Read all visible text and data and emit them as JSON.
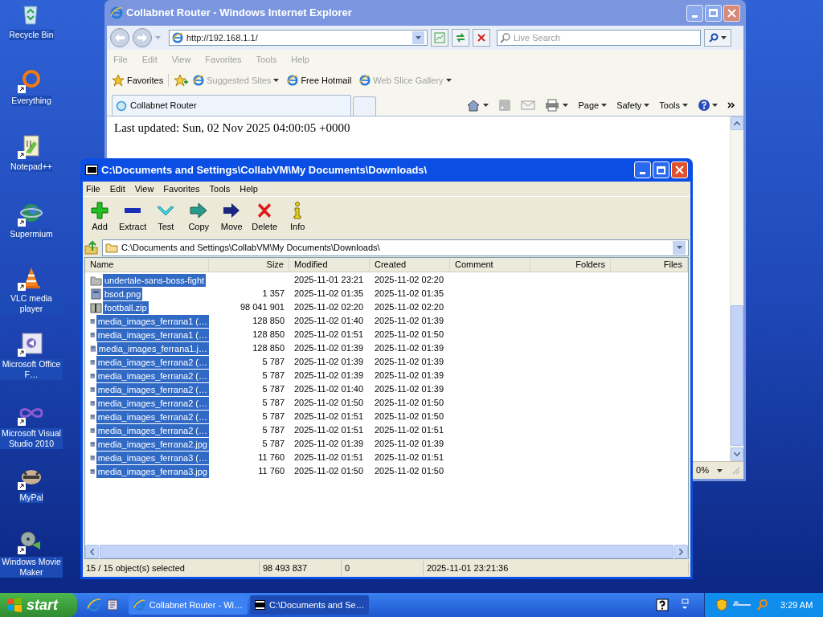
{
  "desktop_icons": [
    {
      "label": "Recycle Bin",
      "kind": "bin",
      "shortcut": false
    },
    {
      "label": "Everything",
      "kind": "ring",
      "shortcut": true
    },
    {
      "label": "Notepad++",
      "kind": "notepad",
      "shortcut": true
    },
    {
      "label": "Supermium",
      "kind": "globe",
      "shortcut": true
    },
    {
      "label": "VLC media player",
      "kind": "cone",
      "shortcut": true
    },
    {
      "label": "Microsoft Office F…",
      "kind": "office",
      "shortcut": true
    },
    {
      "label": "Microsoft Visual Studio 2010",
      "kind": "infinity",
      "shortcut": true
    },
    {
      "label": "MyPal",
      "kind": "raccoon",
      "shortcut": true
    },
    {
      "label": "Windows Movie Maker",
      "kind": "film",
      "shortcut": true
    }
  ],
  "browser": {
    "title": "Collabnet Router - Windows Internet Explorer",
    "address": "http://192.168.1.1/",
    "search_placeholder": "Live Search",
    "menu": [
      "File",
      "Edit",
      "View",
      "Favorites",
      "Tools",
      "Help"
    ],
    "favorites_label": "Favorites",
    "favorites_items": [
      {
        "label": "Suggested Sites",
        "disabled": true,
        "dropdown": true
      },
      {
        "label": "Free Hotmail",
        "disabled": false,
        "dropdown": false
      },
      {
        "label": "Web Slice Gallery",
        "disabled": true,
        "dropdown": true
      }
    ],
    "tab": "Collabnet Router",
    "commands": [
      "Page",
      "Safety",
      "Tools"
    ],
    "content": "Last updated: Sun, 02 Nov 2025 04:00:05 +0000",
    "zoom": "0%"
  },
  "archiver": {
    "title": "C:\\Documents and Settings\\CollabVM\\My Documents\\Downloads\\",
    "menu": [
      "File",
      "Edit",
      "View",
      "Favorites",
      "Tools",
      "Help"
    ],
    "toolbar": [
      {
        "label": "Add",
        "kind": "add"
      },
      {
        "label": "Extract",
        "kind": "extract"
      },
      {
        "label": "Test",
        "kind": "test"
      },
      {
        "label": "Copy",
        "kind": "copy"
      },
      {
        "label": "Move",
        "kind": "move"
      },
      {
        "label": "Delete",
        "kind": "delete"
      },
      {
        "label": "Info",
        "kind": "info"
      }
    ],
    "path": "C:\\Documents and Settings\\CollabVM\\My Documents\\Downloads\\",
    "columns": [
      "Name",
      "Size",
      "Modified",
      "Created",
      "Comment",
      "Folders",
      "Files"
    ],
    "rows": [
      {
        "name": "undertale-sans-boss-fight",
        "size": "",
        "modified": "2025-11-01 23:21",
        "created": "2025-11-02 02:20",
        "kind": "folder",
        "selected": true
      },
      {
        "name": "bsod.png",
        "size": "1 357",
        "modified": "2025-11-02 01:35",
        "created": "2025-11-02 01:35",
        "kind": "image",
        "selected": true
      },
      {
        "name": "football.zip",
        "size": "98 041 901",
        "modified": "2025-11-02 02:20",
        "created": "2025-11-02 02:20",
        "kind": "archive",
        "selected": true
      },
      {
        "name": "media_images_ferrana1 (…",
        "size": "128 850",
        "modified": "2025-11-02 01:40",
        "created": "2025-11-02 01:39",
        "kind": "image",
        "selected": true
      },
      {
        "name": "media_images_ferrana1 (…",
        "size": "128 850",
        "modified": "2025-11-02 01:51",
        "created": "2025-11-02 01:50",
        "kind": "image",
        "selected": true
      },
      {
        "name": "media_images_ferrana1.j…",
        "size": "128 850",
        "modified": "2025-11-02 01:39",
        "created": "2025-11-02 01:39",
        "kind": "image",
        "selected": true
      },
      {
        "name": "media_images_ferrana2 (…",
        "size": "5 787",
        "modified": "2025-11-02 01:39",
        "created": "2025-11-02 01:39",
        "kind": "image",
        "selected": true
      },
      {
        "name": "media_images_ferrana2 (…",
        "size": "5 787",
        "modified": "2025-11-02 01:39",
        "created": "2025-11-02 01:39",
        "kind": "image",
        "selected": true
      },
      {
        "name": "media_images_ferrana2 (…",
        "size": "5 787",
        "modified": "2025-11-02 01:40",
        "created": "2025-11-02 01:39",
        "kind": "image",
        "selected": true
      },
      {
        "name": "media_images_ferrana2 (…",
        "size": "5 787",
        "modified": "2025-11-02 01:50",
        "created": "2025-11-02 01:50",
        "kind": "image",
        "selected": true
      },
      {
        "name": "media_images_ferrana2 (…",
        "size": "5 787",
        "modified": "2025-11-02 01:51",
        "created": "2025-11-02 01:50",
        "kind": "image",
        "selected": true
      },
      {
        "name": "media_images_ferrana2 (…",
        "size": "5 787",
        "modified": "2025-11-02 01:51",
        "created": "2025-11-02 01:51",
        "kind": "image",
        "selected": true
      },
      {
        "name": "media_images_ferrana2.jpg",
        "size": "5 787",
        "modified": "2025-11-02 01:39",
        "created": "2025-11-02 01:39",
        "kind": "image",
        "selected": true
      },
      {
        "name": "media_images_ferrana3 (…",
        "size": "11 760",
        "modified": "2025-11-02 01:51",
        "created": "2025-11-02 01:51",
        "kind": "image",
        "selected": true
      },
      {
        "name": "media_images_ferrana3.jpg",
        "size": "11 760",
        "modified": "2025-11-02 01:50",
        "created": "2025-11-02 01:50",
        "kind": "image",
        "selected": true
      }
    ],
    "status": [
      "15 / 15 object(s) selected",
      "98 493 837",
      "0",
      "2025-11-01 23:21:36"
    ]
  },
  "taskbar": {
    "start": "start",
    "tasks": [
      {
        "label": "Collabnet Router - Wi…",
        "kind": "browser",
        "selected": false
      },
      {
        "label": "C:\\Documents and Se…",
        "kind": "archiver",
        "selected": true
      }
    ],
    "clock": "3:29 AM"
  }
}
